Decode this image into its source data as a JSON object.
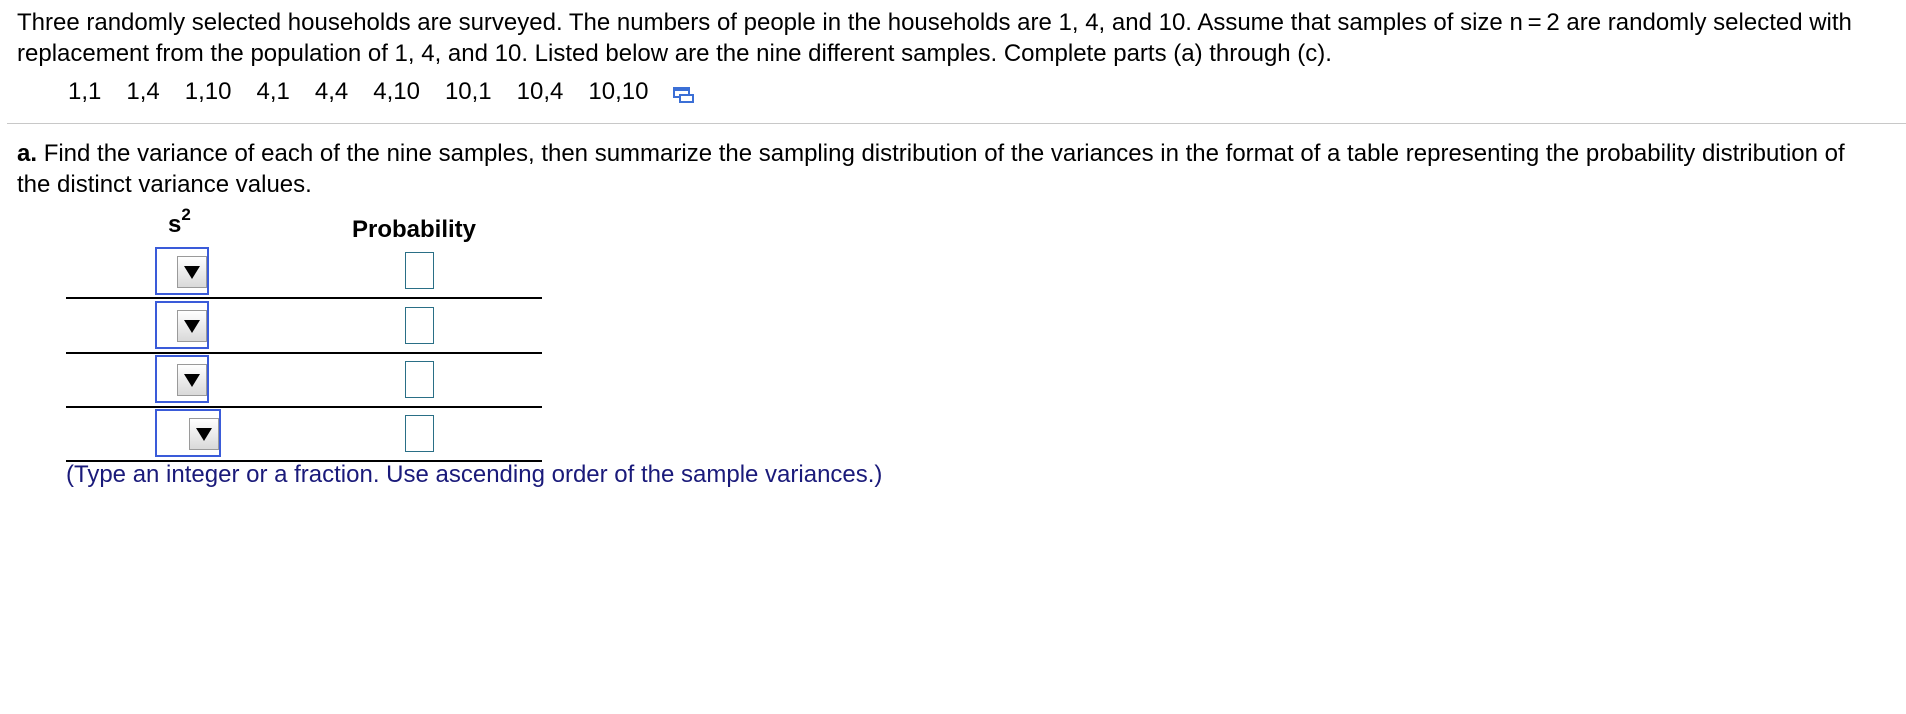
{
  "problem": {
    "text": "Three randomly selected households are surveyed. The numbers of people in the households are 1, 4, and 10. Assume that samples of size n = 2 are randomly selected with replacement from the population of 1, 4, and 10. Listed below are the nine different samples. Complete parts (a) through (c).",
    "samples": [
      "1,1",
      "1,4",
      "1,10",
      "4,1",
      "4,4",
      "4,10",
      "10,1",
      "10,4",
      "10,10"
    ],
    "copy_icon": "copy-icon"
  },
  "part_a": {
    "label": "a.",
    "text": "Find the variance of each of the nine samples, then summarize the sampling distribution of the variances in the format of a table representing the probability distribution of the distinct variance values."
  },
  "table": {
    "header_s": "s",
    "header_exp": "2",
    "header_prob": "Probability",
    "rows": [
      {
        "s2_selected": "",
        "probability": ""
      },
      {
        "s2_selected": "",
        "probability": ""
      },
      {
        "s2_selected": "",
        "probability": ""
      },
      {
        "s2_selected": "",
        "probability": ""
      }
    ],
    "dropdown_icon": "triangle-down-icon"
  },
  "hint": "(Type an integer or a fraction. Use ascending order of the sample variances.)",
  "colors": {
    "dropdown_border": "#3a5bd9",
    "input_border": "#2a6f86",
    "hint_text": "#1a1a7a",
    "divider": "#c8c8c8"
  }
}
